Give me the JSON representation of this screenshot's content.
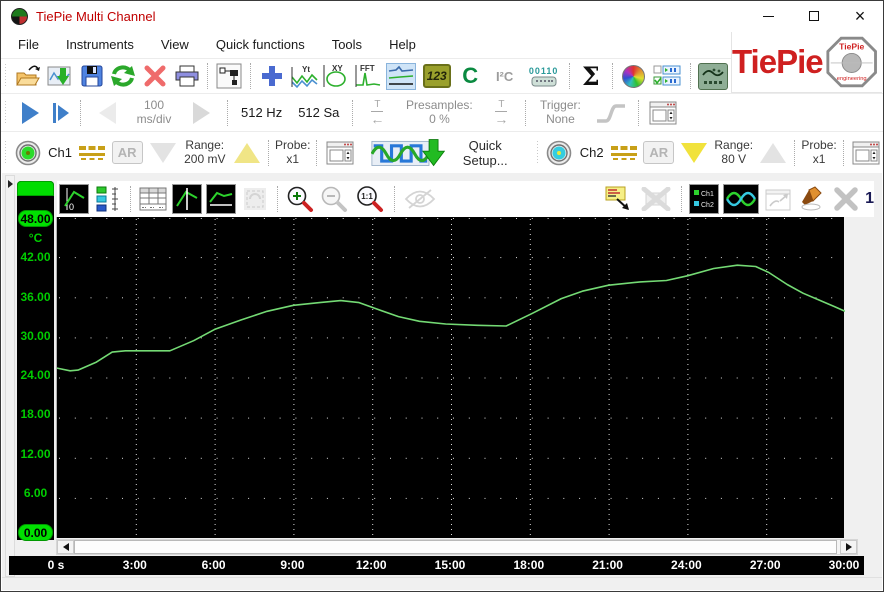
{
  "window": {
    "title": "TiePie Multi Channel"
  },
  "menu": {
    "items": [
      "File",
      "Instruments",
      "View",
      "Quick functions",
      "Tools",
      "Help"
    ]
  },
  "logo": {
    "brand": "TiePie",
    "badge_top": "TiePie",
    "badge_bottom": "engineering"
  },
  "toolbar_measure": {
    "timebase_value": "100",
    "timebase_unit": "ms/div",
    "sample_rate": "512 Hz",
    "record_length": "512 Sa",
    "presamples_label": "Presamples:",
    "presamples_value": "0 %",
    "trigger_label": "Trigger:",
    "trigger_value": "None"
  },
  "toolbar_channels": {
    "ch1": {
      "label": "Ch1",
      "ar": "AR",
      "range_label": "Range:",
      "range_value": "200 mV",
      "probe_label": "Probe:",
      "probe_value": "x1"
    },
    "quick_setup_label": "Quick Setup...",
    "ch2": {
      "label": "Ch2",
      "ar": "AR",
      "range_label": "Range:",
      "range_value": "80 V",
      "probe_label": "Probe:",
      "probe_value": "x1"
    }
  },
  "graph": {
    "counter": "1"
  },
  "icons": {
    "app": "tiepie-app-icon",
    "yt": "Yt",
    "xy": "XY",
    "fft": "FFT",
    "meter": "123",
    "gauge": "C",
    "i2c": "I²C",
    "protocol": "00110",
    "sum": "Σ",
    "zoom_reset": "1:1",
    "legend_ch1": "Ch1",
    "legend_ch2": "Ch2",
    "axis_zero": "0"
  },
  "chart_data": {
    "type": "line",
    "title": "",
    "x_ticks": [
      "0 s",
      "3:00",
      "6:00",
      "9:00",
      "12:00",
      "15:00",
      "18:00",
      "21:00",
      "24:00",
      "27:00",
      "30:00"
    ],
    "y_ticks": [
      "48.00",
      "42.00",
      "36.00",
      "30.00",
      "24.00",
      "18.00",
      "12.00",
      "6.00",
      "0.00"
    ],
    "x_range_minutes": [
      0,
      30
    ],
    "y_range": [
      0,
      48
    ],
    "y_unit": "°C",
    "grid": "dotted",
    "legend_position": "none",
    "series": [
      {
        "name": "Ch1",
        "color": "#74da74",
        "points": [
          [
            0,
            25.4
          ],
          [
            0.5,
            25.0
          ],
          [
            0.8,
            25.1
          ],
          [
            1.5,
            26.3
          ],
          [
            2.1,
            27.8
          ],
          [
            2.6,
            28.0
          ],
          [
            4.3,
            28.0
          ],
          [
            5.2,
            29.5
          ],
          [
            6.0,
            31.2
          ],
          [
            7.0,
            32.6
          ],
          [
            8.0,
            33.9
          ],
          [
            9.0,
            34.8
          ],
          [
            10.0,
            35.2
          ],
          [
            10.8,
            35.5
          ],
          [
            11.5,
            35.2
          ],
          [
            12.2,
            34.2
          ],
          [
            13.0,
            33.1
          ],
          [
            13.8,
            32.4
          ],
          [
            14.8,
            32.0
          ],
          [
            16.0,
            31.8
          ],
          [
            17.1,
            31.7
          ],
          [
            18.1,
            33.6
          ],
          [
            19.2,
            35.8
          ],
          [
            20.0,
            36.9
          ],
          [
            21.0,
            37.8
          ],
          [
            22.2,
            38.3
          ],
          [
            23.2,
            38.5
          ],
          [
            24.0,
            39.2
          ],
          [
            25.0,
            40.3
          ],
          [
            25.9,
            40.8
          ],
          [
            26.6,
            40.6
          ],
          [
            27.1,
            39.7
          ],
          [
            27.8,
            37.9
          ],
          [
            28.4,
            36.6
          ],
          [
            29.0,
            35.6
          ],
          [
            29.6,
            34.6
          ],
          [
            30,
            33.9
          ]
        ]
      }
    ]
  }
}
